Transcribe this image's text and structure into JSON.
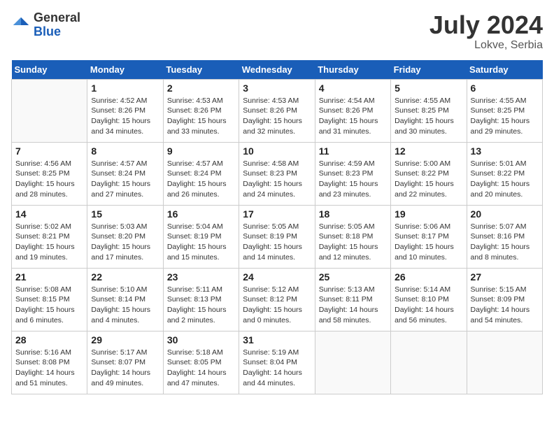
{
  "header": {
    "logo_general": "General",
    "logo_blue": "Blue",
    "title": "July 2024",
    "location": "Lokve, Serbia"
  },
  "days_of_week": [
    "Sunday",
    "Monday",
    "Tuesday",
    "Wednesday",
    "Thursday",
    "Friday",
    "Saturday"
  ],
  "weeks": [
    [
      {
        "day": "",
        "detail": ""
      },
      {
        "day": "1",
        "detail": "Sunrise: 4:52 AM\nSunset: 8:26 PM\nDaylight: 15 hours\nand 34 minutes."
      },
      {
        "day": "2",
        "detail": "Sunrise: 4:53 AM\nSunset: 8:26 PM\nDaylight: 15 hours\nand 33 minutes."
      },
      {
        "day": "3",
        "detail": "Sunrise: 4:53 AM\nSunset: 8:26 PM\nDaylight: 15 hours\nand 32 minutes."
      },
      {
        "day": "4",
        "detail": "Sunrise: 4:54 AM\nSunset: 8:26 PM\nDaylight: 15 hours\nand 31 minutes."
      },
      {
        "day": "5",
        "detail": "Sunrise: 4:55 AM\nSunset: 8:25 PM\nDaylight: 15 hours\nand 30 minutes."
      },
      {
        "day": "6",
        "detail": "Sunrise: 4:55 AM\nSunset: 8:25 PM\nDaylight: 15 hours\nand 29 minutes."
      }
    ],
    [
      {
        "day": "7",
        "detail": "Sunrise: 4:56 AM\nSunset: 8:25 PM\nDaylight: 15 hours\nand 28 minutes."
      },
      {
        "day": "8",
        "detail": "Sunrise: 4:57 AM\nSunset: 8:24 PM\nDaylight: 15 hours\nand 27 minutes."
      },
      {
        "day": "9",
        "detail": "Sunrise: 4:57 AM\nSunset: 8:24 PM\nDaylight: 15 hours\nand 26 minutes."
      },
      {
        "day": "10",
        "detail": "Sunrise: 4:58 AM\nSunset: 8:23 PM\nDaylight: 15 hours\nand 24 minutes."
      },
      {
        "day": "11",
        "detail": "Sunrise: 4:59 AM\nSunset: 8:23 PM\nDaylight: 15 hours\nand 23 minutes."
      },
      {
        "day": "12",
        "detail": "Sunrise: 5:00 AM\nSunset: 8:22 PM\nDaylight: 15 hours\nand 22 minutes."
      },
      {
        "day": "13",
        "detail": "Sunrise: 5:01 AM\nSunset: 8:22 PM\nDaylight: 15 hours\nand 20 minutes."
      }
    ],
    [
      {
        "day": "14",
        "detail": "Sunrise: 5:02 AM\nSunset: 8:21 PM\nDaylight: 15 hours\nand 19 minutes."
      },
      {
        "day": "15",
        "detail": "Sunrise: 5:03 AM\nSunset: 8:20 PM\nDaylight: 15 hours\nand 17 minutes."
      },
      {
        "day": "16",
        "detail": "Sunrise: 5:04 AM\nSunset: 8:19 PM\nDaylight: 15 hours\nand 15 minutes."
      },
      {
        "day": "17",
        "detail": "Sunrise: 5:05 AM\nSunset: 8:19 PM\nDaylight: 15 hours\nand 14 minutes."
      },
      {
        "day": "18",
        "detail": "Sunrise: 5:05 AM\nSunset: 8:18 PM\nDaylight: 15 hours\nand 12 minutes."
      },
      {
        "day": "19",
        "detail": "Sunrise: 5:06 AM\nSunset: 8:17 PM\nDaylight: 15 hours\nand 10 minutes."
      },
      {
        "day": "20",
        "detail": "Sunrise: 5:07 AM\nSunset: 8:16 PM\nDaylight: 15 hours\nand 8 minutes."
      }
    ],
    [
      {
        "day": "21",
        "detail": "Sunrise: 5:08 AM\nSunset: 8:15 PM\nDaylight: 15 hours\nand 6 minutes."
      },
      {
        "day": "22",
        "detail": "Sunrise: 5:10 AM\nSunset: 8:14 PM\nDaylight: 15 hours\nand 4 minutes."
      },
      {
        "day": "23",
        "detail": "Sunrise: 5:11 AM\nSunset: 8:13 PM\nDaylight: 15 hours\nand 2 minutes."
      },
      {
        "day": "24",
        "detail": "Sunrise: 5:12 AM\nSunset: 8:12 PM\nDaylight: 15 hours\nand 0 minutes."
      },
      {
        "day": "25",
        "detail": "Sunrise: 5:13 AM\nSunset: 8:11 PM\nDaylight: 14 hours\nand 58 minutes."
      },
      {
        "day": "26",
        "detail": "Sunrise: 5:14 AM\nSunset: 8:10 PM\nDaylight: 14 hours\nand 56 minutes."
      },
      {
        "day": "27",
        "detail": "Sunrise: 5:15 AM\nSunset: 8:09 PM\nDaylight: 14 hours\nand 54 minutes."
      }
    ],
    [
      {
        "day": "28",
        "detail": "Sunrise: 5:16 AM\nSunset: 8:08 PM\nDaylight: 14 hours\nand 51 minutes."
      },
      {
        "day": "29",
        "detail": "Sunrise: 5:17 AM\nSunset: 8:07 PM\nDaylight: 14 hours\nand 49 minutes."
      },
      {
        "day": "30",
        "detail": "Sunrise: 5:18 AM\nSunset: 8:05 PM\nDaylight: 14 hours\nand 47 minutes."
      },
      {
        "day": "31",
        "detail": "Sunrise: 5:19 AM\nSunset: 8:04 PM\nDaylight: 14 hours\nand 44 minutes."
      },
      {
        "day": "",
        "detail": ""
      },
      {
        "day": "",
        "detail": ""
      },
      {
        "day": "",
        "detail": ""
      }
    ]
  ]
}
